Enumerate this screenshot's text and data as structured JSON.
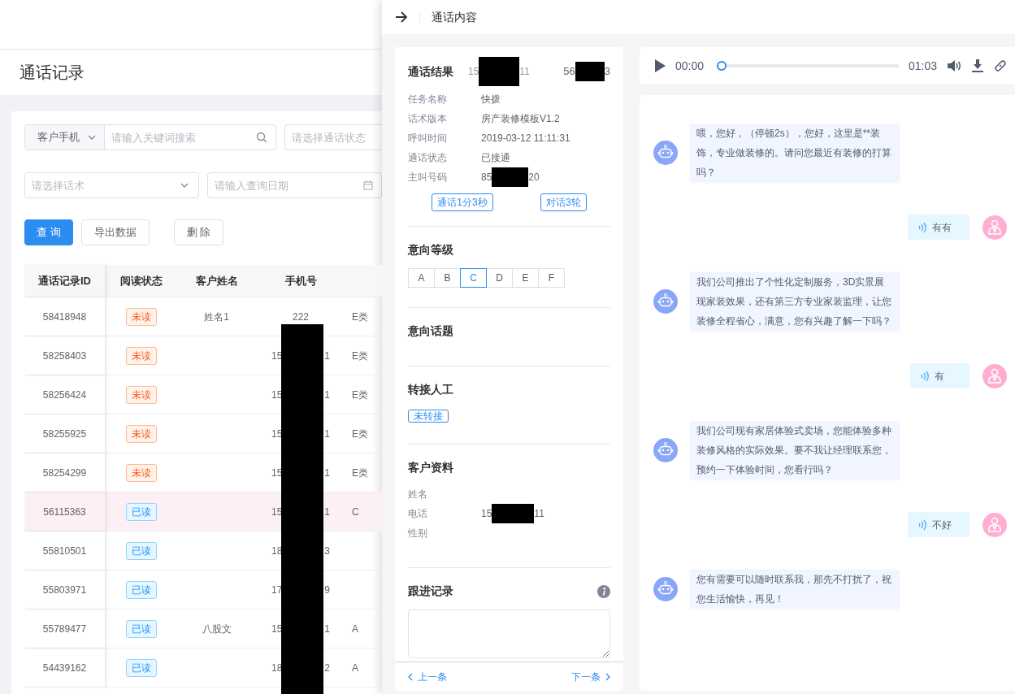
{
  "page": {
    "title": "通话记录"
  },
  "filters": {
    "search_type": "客户手机",
    "search_placeholder": "请输入关键词搜索",
    "status_placeholder": "请选择通话状态",
    "script_placeholder": "请选择话术",
    "date_placeholder": "请输入查询日期"
  },
  "buttons": [
    {
      "label": "查 询",
      "kind": "primary"
    },
    {
      "label": "导出数据",
      "kind": "default"
    },
    {
      "label": "删 除",
      "kind": "default"
    }
  ],
  "table": {
    "columns": [
      "通话记录ID",
      "阅读状态",
      "客户姓名",
      "手机号"
    ],
    "rows": [
      {
        "id": "58418948",
        "read_status": "未读",
        "read": false,
        "name": "姓名1",
        "phone": {
          "start": "222"
        },
        "column_5": "E类",
        "selected": false
      },
      {
        "id": "58258403",
        "read_status": "未读",
        "read": false,
        "phone": {
          "start": "15",
          "end": "1"
        },
        "column_5": "E类",
        "selected": false
      },
      {
        "id": "58256424",
        "read_status": "未读",
        "read": false,
        "phone": {
          "start": "15",
          "end": "1"
        },
        "column_5": "E类",
        "selected": false
      },
      {
        "id": "58255925",
        "read_status": "未读",
        "read": false,
        "phone": {
          "start": "15",
          "end": "1"
        },
        "column_5": "E类",
        "selected": false
      },
      {
        "id": "58254299",
        "read_status": "未读",
        "read": false,
        "phone": {
          "start": "15",
          "end": "1"
        },
        "column_5": "E类",
        "selected": false
      },
      {
        "id": "56115363",
        "read_status": "已读",
        "read": true,
        "phone": {
          "start": "15",
          "end": "1"
        },
        "column_5": "C",
        "selected": true
      },
      {
        "id": "55810501",
        "read_status": "已读",
        "read": true,
        "phone": {
          "start": "18",
          "end": "3"
        },
        "selected": false
      },
      {
        "id": "55803971",
        "read_status": "已读",
        "read": true,
        "phone": {
          "start": "17",
          "end": "9"
        },
        "selected": false
      },
      {
        "id": "55789477",
        "read_status": "已读",
        "read": true,
        "name": "八股文",
        "phone": {
          "start": "15",
          "end": "1"
        },
        "column_5": "A",
        "selected": false
      },
      {
        "id": "54439162",
        "read_status": "已读",
        "read": true,
        "phone": {
          "start": "18",
          "end": "2"
        },
        "column_5": "A",
        "selected": false
      }
    ]
  },
  "drawer": {
    "title": "通话内容",
    "result": {
      "title": "通话结果",
      "phone": {
        "start": "15",
        "end": "11"
      },
      "record": {
        "start": "56",
        "end": "3"
      }
    },
    "fields": [
      {
        "label": "任务名称",
        "value": "快拨"
      },
      {
        "label": "话术版本",
        "value": "房产装修模板V1.2"
      },
      {
        "label": "呼叫时间",
        "value": "2019-03-12 11:11:31"
      },
      {
        "label": "通话状态",
        "value": "已接通"
      },
      {
        "label": "主叫号码",
        "redacted": {
          "start": "85",
          "end": "20"
        }
      }
    ],
    "tags": [
      "通话1分3秒",
      "对话3轮"
    ],
    "intent_level": {
      "title": "意向等级",
      "options": [
        {
          "label": "A",
          "selected": false
        },
        {
          "label": "B",
          "selected": false
        },
        {
          "label": "C",
          "selected": true
        },
        {
          "label": "D",
          "selected": false
        },
        {
          "label": "E",
          "selected": false
        },
        {
          "label": "F",
          "selected": false
        }
      ]
    },
    "intent_topic": {
      "title": "意向话题"
    },
    "transfer": {
      "title": "转接人工",
      "tag": "未转接"
    },
    "customer": {
      "title": "客户资料",
      "fields": [
        {
          "label": "姓名"
        },
        {
          "label": "电话",
          "redacted": {
            "start": "15",
            "end": "11"
          }
        },
        {
          "label": "性别"
        }
      ]
    },
    "follow_up": {
      "title": "跟进记录"
    },
    "nav": {
      "prev": "上一条",
      "next": "下一条"
    }
  },
  "player": {
    "current": "00:00",
    "total": "01:03",
    "level": 0
  },
  "messages": [
    {
      "kind": "bot",
      "text": "喂，您好，（停顿2s），您好，这里是**装饰，专业做装修的。请问您最近有装修的打算吗？"
    },
    {
      "kind": "user",
      "text": "有有"
    },
    {
      "kind": "bot",
      "text": "我们公司推出了个性化定制服务，3D实景展现家装效果，还有第三方专业家装监理，让您装修全程省心，满意，您有兴趣了解一下吗？"
    },
    {
      "kind": "user",
      "text": "有"
    },
    {
      "kind": "bot",
      "text": "我们公司现有家居体验式卖场，您能体验多种装修风格的实际效果。要不我让经理联系您，预约一下体验时间，您看行吗？"
    },
    {
      "kind": "user",
      "text": "不好"
    },
    {
      "kind": "bot",
      "text": "您有需要可以随时联系我，那先不打扰了，祝您生活愉快，再见！"
    }
  ]
}
